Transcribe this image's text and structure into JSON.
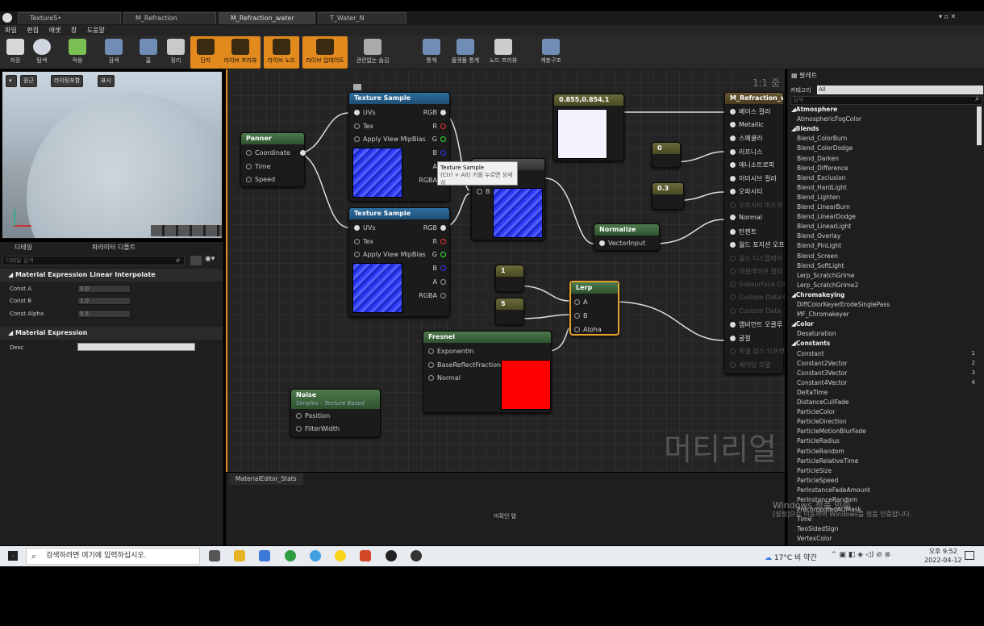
{
  "tabs": [
    {
      "label": "Texture5•",
      "active": false
    },
    {
      "label": "M_Refraction",
      "active": false
    },
    {
      "label": "M_Refraction_water",
      "active": true
    },
    {
      "label": "T_Water_N",
      "active": false
    }
  ],
  "menu": [
    "파일",
    "편집",
    "애셋",
    "창",
    "도움말"
  ],
  "toolbar": [
    "저장",
    "탐색",
    "적용",
    "검색",
    "홈",
    "정리",
    "단자",
    "라이브 프리뷰",
    "라이브 노드",
    "라이브 업데이트",
    "관련없는 숨김",
    "통계",
    "플랫폼 통계",
    "노드 프리뷰",
    "계층구조"
  ],
  "viewport": {
    "buttons": [
      "원근",
      "라이팅포함",
      "표시"
    ]
  },
  "details": {
    "tabs": [
      "디테일",
      "파라미터 디폴트"
    ],
    "search_placeholder": "디테일 검색",
    "sections": [
      {
        "title": "Material Expression Linear Interpolate",
        "props": [
          {
            "label": "Const A",
            "value": "0.0"
          },
          {
            "label": "Const B",
            "value": "1.0"
          },
          {
            "label": "Const Alpha",
            "value": "0.5"
          }
        ]
      },
      {
        "title": "Material Expression",
        "props": [
          {
            "label": "Desc",
            "value": ""
          }
        ]
      }
    ]
  },
  "graph": {
    "zoom": "1:1 줌",
    "watermark": "머티리얼",
    "nodes": {
      "panner": {
        "title": "Panner",
        "pins": [
          "Coordinate",
          "Time",
          "Speed"
        ]
      },
      "tex1": {
        "title": "Texture Sample",
        "inputs": [
          "UVs",
          "Tex",
          "Apply View MipBias"
        ],
        "outputs": [
          "RGB",
          "R",
          "G",
          "B",
          "A",
          "RGBA"
        ]
      },
      "tex2": {
        "title": "Texture Sample",
        "inputs": [
          "UVs",
          "Tex",
          "Apply View MipBias"
        ],
        "outputs": [
          "RGB",
          "R",
          "G",
          "B",
          "A",
          "RGBA"
        ]
      },
      "add": {
        "pins": [
          "A",
          "B"
        ]
      },
      "const3": {
        "title": "0.855,0.854,1"
      },
      "c0": {
        "title": "0"
      },
      "c03": {
        "title": "0.3"
      },
      "normalize": {
        "title": "Normalize",
        "pins": [
          "VectorInput"
        ]
      },
      "c1": {
        "title": "1"
      },
      "c5": {
        "title": "5"
      },
      "lerp": {
        "title": "Lerp",
        "pins": [
          "A",
          "B",
          "Alpha"
        ]
      },
      "fresnel": {
        "title": "Fresnel",
        "pins": [
          "ExponentIn",
          "BaseReflectFractionIn",
          "Normal"
        ]
      },
      "noise": {
        "title": "Noise",
        "subtitle": "Simplex - Texture Based",
        "pins": [
          "Position",
          "FilterWidth"
        ]
      },
      "result": {
        "title": "M_Refraction_wa",
        "pins": [
          "베이스 컬러",
          "Metallic",
          "스페큘러",
          "러프니스",
          "애니소트로피",
          "이미시브 컬러",
          "오파시티",
          "오파시티 마스크",
          "Normal",
          "탄젠트",
          "월드 포지션 오프",
          "월드 디스플레이",
          "테셀레이션 멀티",
          "Subsurface Col",
          "Custom Data 0",
          "Custom Data 1",
          "앰비언트 오클루",
          "굴절",
          "픽셀 뎁스 오프셋",
          "셰이딩 모델"
        ]
      }
    },
    "tooltip": {
      "title": "Texture Sample",
      "hint": "(Ctrl + Alt) 키를 누르면 상세히"
    }
  },
  "stats": {
    "tab": "MaterialEditor_Stats",
    "body": "미확인 탭"
  },
  "palette": {
    "tab": "팔레트",
    "category_label": "카테고리",
    "category_value": "All",
    "search_placeholder": "검색",
    "entries": [
      {
        "cat": "Atmosphere"
      },
      {
        "item": "AtmosphericFogColor"
      },
      {
        "cat": "Blends"
      },
      {
        "item": "Blend_ColorBurn"
      },
      {
        "item": "Blend_ColorDodge"
      },
      {
        "item": "Blend_Darken"
      },
      {
        "item": "Blend_Difference"
      },
      {
        "item": "Blend_Exclusion"
      },
      {
        "item": "Blend_HardLight"
      },
      {
        "item": "Blend_Lighten"
      },
      {
        "item": "Blend_LinearBurn"
      },
      {
        "item": "Blend_LinearDodge"
      },
      {
        "item": "Blend_LinearLight"
      },
      {
        "item": "Blend_Overlay"
      },
      {
        "item": "Blend_PinLight"
      },
      {
        "item": "Blend_Screen"
      },
      {
        "item": "Blend_SoftLight"
      },
      {
        "item": "Lerp_ScratchGrime"
      },
      {
        "item": "Lerp_ScratchGrime2"
      },
      {
        "cat": "Chromakeying"
      },
      {
        "item": "DiffColorKeyerErodeSinglePass"
      },
      {
        "item": "MF_Chromakeyer"
      },
      {
        "cat": "Color"
      },
      {
        "item": "Desaturation"
      },
      {
        "cat": "Constants"
      },
      {
        "item": "Constant",
        "num": "1"
      },
      {
        "item": "Constant2Vector",
        "num": "2"
      },
      {
        "item": "Constant3Vector",
        "num": "3"
      },
      {
        "item": "Constant4Vector",
        "num": "4"
      },
      {
        "item": "DeltaTime"
      },
      {
        "item": "DistanceCullFade"
      },
      {
        "item": "ParticleColor"
      },
      {
        "item": "ParticleDirection"
      },
      {
        "item": "ParticleMotionBlurFade"
      },
      {
        "item": "ParticleRadius"
      },
      {
        "item": "ParticleRandom"
      },
      {
        "item": "ParticleRelativeTime"
      },
      {
        "item": "ParticleSize"
      },
      {
        "item": "ParticleSpeed"
      },
      {
        "item": "PerInstanceFadeAmount"
      },
      {
        "item": "PerInstanceRandom"
      },
      {
        "item": "PrecomputedAOMask"
      },
      {
        "item": "Time"
      },
      {
        "item": "TwoSidedSign"
      },
      {
        "item": "VertexColor"
      }
    ]
  },
  "windows_activation": {
    "title": "Windows 정품 인증",
    "text": "[설정]으로 이동하여 Windows를 정품 인증합니다."
  },
  "taskbar": {
    "search_placeholder": "검색하려면 여기에 입력하십시오.",
    "weather": "17°C 비 약간",
    "time": "오후 9:52",
    "date": "2022-04-12"
  }
}
